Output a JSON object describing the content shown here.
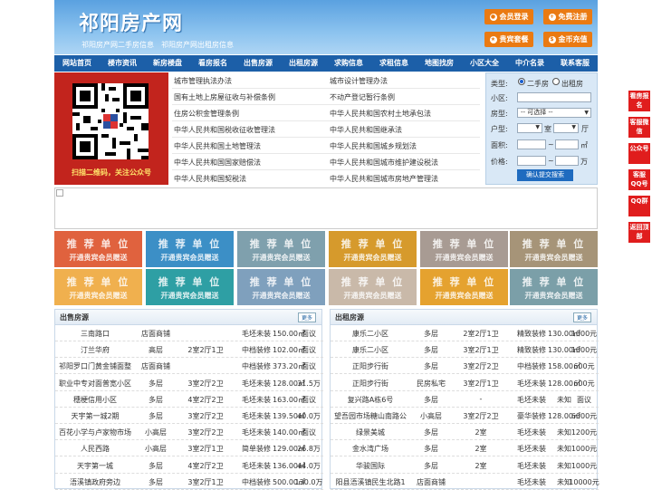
{
  "header": {
    "title": "祁阳房产网",
    "link_second_hand": "祁阳房产网二手房信息",
    "link_rent": "祁阳房产网出租房信息",
    "buttons": [
      {
        "label": "会员登录",
        "icon": "person-icon"
      },
      {
        "label": "免费注册",
        "icon": "person-add-icon"
      },
      {
        "label": "贵宾套餐",
        "icon": "vip-icon"
      },
      {
        "label": "金币充值",
        "icon": "coin-icon"
      }
    ]
  },
  "nav": [
    "网站首页",
    "楼市资讯",
    "新房楼盘",
    "看房报名",
    "出售房源",
    "出租房源",
    "求购信息",
    "求租信息",
    "地图找房",
    "小区大全",
    "中介名录",
    "联系客服"
  ],
  "qr": {
    "caption": "扫描二维码，关注公众号"
  },
  "laws": [
    [
      "城市管理执法办法",
      "城市设计管理办法"
    ],
    [
      "国有土地上房屋征收与补偿条例",
      "不动产登记暂行条例"
    ],
    [
      "住房公积金管理条例",
      "中华人民共和国农村土地承包法"
    ],
    [
      "中华人民共和国税收征收管理法",
      "中华人民共和国继承法"
    ],
    [
      "中华人民共和国土地管理法",
      "中华人民共和国城乡规划法"
    ],
    [
      "中华人民共和国国家赔偿法",
      "中华人民共和国城市维护建设税法"
    ],
    [
      "中华人民共和国契税法",
      "中华人民共和国城市房地产管理法"
    ]
  ],
  "search": {
    "type_label": "类型:",
    "opt_sale": "二手房",
    "opt_rent": "出租房",
    "community_label": "小区:",
    "room_label": "房型:",
    "room_select": "-- 可选择 --",
    "layout_label": "户型:",
    "unit_room": "室",
    "unit_hall": "厅",
    "area_label": "面积:",
    "area_unit": "㎡",
    "price_label": "价格:",
    "price_unit": "万",
    "tilde": "~",
    "submit": "确认提交搜索"
  },
  "ads": {
    "line1": "推 荐 单 位",
    "line2": "开通贵宾会员赠送",
    "colors": [
      "#e0623e",
      "#3c8fc6",
      "#7fa0ad",
      "#d69a2c",
      "#a89b93",
      "#a69478",
      "#f0b04e",
      "#2e9fa4",
      "#7fa0bd",
      "#c9b9a9",
      "#e5a22f",
      "#7b9fa8"
    ]
  },
  "sale": {
    "title": "出售房源",
    "more": "更多",
    "rows": [
      [
        "三南路口",
        "店面商铺",
        "",
        "毛坯未装",
        "150.00㎡",
        "面议"
      ],
      [
        "汀兰华府",
        "高层",
        "2室2厅1卫",
        "中档装修",
        "102.00㎡",
        "面议"
      ],
      [
        "祁阳罗口门黄金铺面整",
        "店面商铺",
        "",
        "中档装修",
        "373.20㎡",
        "面议"
      ],
      [
        "职业中专对面普宽小区",
        "多层",
        "3室2厅2卫",
        "毛坯未装",
        "128.00㎡",
        "31.5万"
      ],
      [
        "穗梗信用小区",
        "多层",
        "4室2厅2卫",
        "毛坯未装",
        "163.00㎡",
        "面议"
      ],
      [
        "天宇第一城2期",
        "多层",
        "3室2厅2卫",
        "毛坯未装",
        "139.50㎡",
        "40.0万"
      ],
      [
        "百花小学与卢家物市场",
        "小高层",
        "3室2厅2卫",
        "毛坯未装",
        "140.00㎡",
        "面议"
      ],
      [
        "人民西路",
        "小高层",
        "3室2厅1卫",
        "简单装修",
        "129.00㎡",
        "26.8万"
      ],
      [
        "天宇第一城",
        "多层",
        "4室2厅2卫",
        "毛坯未装",
        "136.00㎡",
        "44.0万"
      ],
      [
        "浯溪镇政府旁边",
        "多层",
        "3室2厅1卫",
        "中档装修",
        "500.00㎡",
        "130.0万"
      ]
    ]
  },
  "rent": {
    "title": "出租房源",
    "more": "更多",
    "rows": [
      [
        "康乐二小区",
        "多层",
        "2室2厅1卫",
        "精致装修",
        "130.00㎡",
        "1000元"
      ],
      [
        "康乐二小区",
        "多层",
        "3室2厅1卫",
        "精致装修",
        "130.00㎡",
        "1000元"
      ],
      [
        "正阳步行街",
        "多层",
        "3室2厅2卫",
        "中档装修",
        "158.00㎡",
        "600元"
      ],
      [
        "正阳步行街",
        "民房私宅",
        "3室2厅1卫",
        "毛坯未装",
        "128.00㎡",
        "600元"
      ],
      [
        "复兴路A栋6号",
        "多层",
        "-",
        "毛坯未装",
        "未知",
        "面议"
      ],
      [
        "望吾园市场糖山南路公",
        "小高层",
        "3室2厅2卫",
        "豪华装修",
        "128.00㎡",
        "6000元"
      ],
      [
        "绿景美城",
        "多层",
        "2室",
        "毛坯未装",
        "未知",
        "1200元"
      ],
      [
        "金水湾广场",
        "多层",
        "2室",
        "毛坯未装",
        "未知",
        "1000元"
      ],
      [
        "华骏国际",
        "多层",
        "2室",
        "毛坯未装",
        "未知",
        "1000元"
      ],
      [
        "阳县浯溪镇民生北路1",
        "店面商铺",
        "",
        "毛坯未装",
        "未知",
        "10000元"
      ]
    ]
  },
  "sidebar": [
    "看房报名",
    "客服微信",
    "公众号",
    "客服QQ号",
    "QQ群",
    "返回顶部"
  ]
}
